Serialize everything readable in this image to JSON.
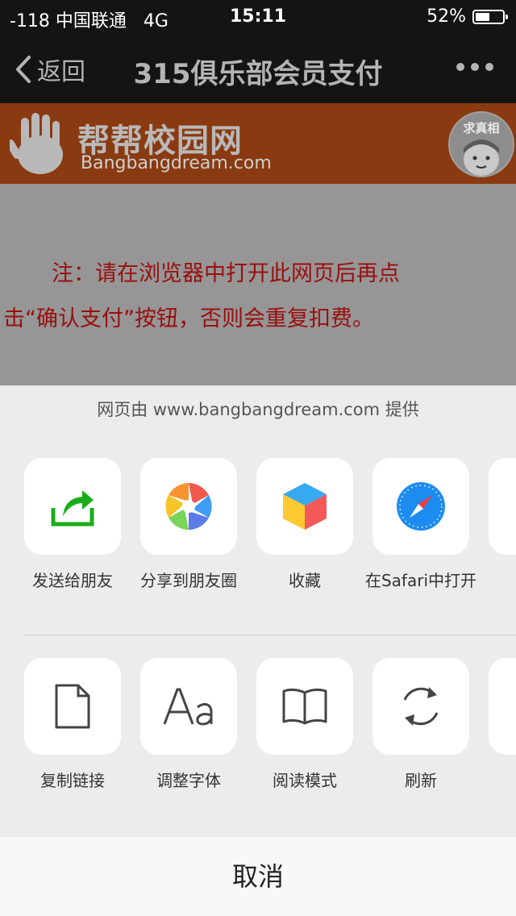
{
  "status_bar": {
    "carrier": "-118 中国联通",
    "network": "4G",
    "time": "15:11",
    "battery": "52%",
    "battery_level": 0.52
  },
  "nav": {
    "back_label": "返回",
    "title": "315俱乐部会员支付"
  },
  "banner": {
    "brand_cn": "帮帮校园网",
    "brand_en": "Bangbangdream.com",
    "badge": "求真相"
  },
  "notice": {
    "line1": "注：请在浏览器中打开此网页后再点",
    "line2": "击“确认支付”按钮，否则会重复扣费。"
  },
  "sheet": {
    "provider": "网页由 www.bangbangdream.com 提供",
    "row1": [
      {
        "label": "发送给朋友",
        "icon": "share-arrow-icon"
      },
      {
        "label": "分享到朋友圈",
        "icon": "moments-aperture-icon"
      },
      {
        "label": "收藏",
        "icon": "favorite-cube-icon"
      },
      {
        "label": "在Safari中打开",
        "icon": "safari-compass-icon"
      }
    ],
    "row2": [
      {
        "label": "复制链接",
        "icon": "document-icon"
      },
      {
        "label": "调整字体",
        "icon": "font-aa-icon"
      },
      {
        "label": "阅读模式",
        "icon": "book-icon"
      },
      {
        "label": "刷新",
        "icon": "refresh-icon"
      }
    ],
    "cancel": "取消"
  },
  "colors": {
    "bar_bg": "#141414",
    "banner_orange": "#8a3a10",
    "notice_red": "#9a0e0e",
    "share_green": "#1aad19",
    "safari_blue": "#1d8cf0"
  }
}
